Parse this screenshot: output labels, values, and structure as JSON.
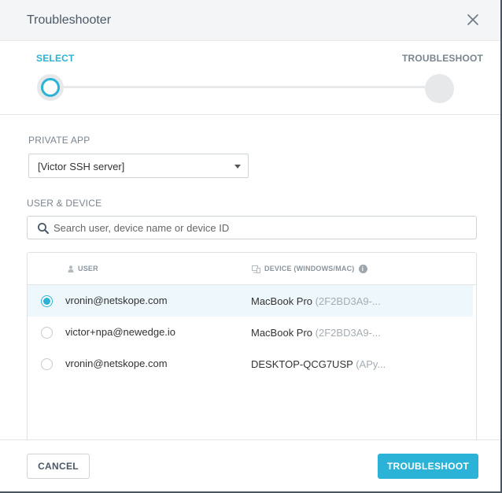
{
  "dialog": {
    "title": "Troubleshooter"
  },
  "stepper": {
    "steps": [
      {
        "label": "SELECT",
        "active": true
      },
      {
        "label": "TROUBLESHOOT",
        "active": false
      }
    ]
  },
  "private_app": {
    "label": "PRIVATE APP",
    "selected": "[Victor SSH server]"
  },
  "user_device": {
    "label": "USER & DEVICE",
    "search_placeholder": "Search user, device name or device ID"
  },
  "table": {
    "columns": {
      "user": "USER",
      "device": "DEVICE (WINDOWS/MAC)"
    },
    "rows": [
      {
        "user": "vronin@netskope.com",
        "device_name": "MacBook Pro",
        "device_id": "(2F2BD3A9-...",
        "selected": true
      },
      {
        "user": "victor+npa@newedge.io",
        "device_name": "MacBook Pro",
        "device_id": "(2F2BD3A9-...",
        "selected": false
      },
      {
        "user": "vronin@netskope.com",
        "device_name": "DESKTOP-QCG7USP",
        "device_id": "(APy...",
        "selected": false
      }
    ]
  },
  "footer": {
    "cancel_label": "CANCEL",
    "troubleshoot_label": "TROUBLESHOOT"
  },
  "colors": {
    "accent": "#2ab3d6",
    "selected_row": "#eef7fb"
  }
}
